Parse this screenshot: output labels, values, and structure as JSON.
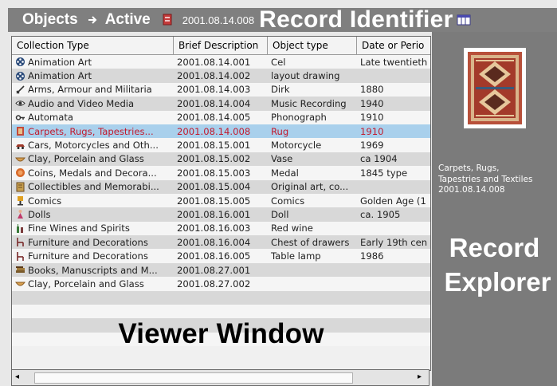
{
  "header": {
    "objects_label": "Objects",
    "active_label": "Active",
    "record_id": "2001.08.14.008",
    "overlay_title": "Record Identifier"
  },
  "list": {
    "columns": [
      "Collection Type",
      "Brief Description",
      "Object type",
      "Date or Perio"
    ],
    "rows": [
      {
        "icon": "film-reel-icon",
        "collection": "Animation Art",
        "brief": "2001.08.14.001",
        "object": "Cel",
        "date": "Late twentieth"
      },
      {
        "icon": "film-reel-icon",
        "collection": "Animation Art",
        "brief": "2001.08.14.002",
        "object": "layout drawing",
        "date": ""
      },
      {
        "icon": "sword-icon",
        "collection": "Arms, Armour and Militaria",
        "brief": "2001.08.14.003",
        "object": "Dirk",
        "date": "1880"
      },
      {
        "icon": "eye-icon",
        "collection": "Audio and Video Media",
        "brief": "2001.08.14.004",
        "object": "Music Recording",
        "date": "1940"
      },
      {
        "icon": "key-icon",
        "collection": "Automata",
        "brief": "2001.08.14.005",
        "object": "Phonograph",
        "date": "1910"
      },
      {
        "icon": "rug-icon",
        "collection": "Carpets, Rugs, Tapestries...",
        "brief": "2001.08.14.008",
        "object": "Rug",
        "date": "1910",
        "selected": true
      },
      {
        "icon": "car-icon",
        "collection": "Cars, Motorcycles and Oth...",
        "brief": "2001.08.15.001",
        "object": "Motorcycle",
        "date": "1969"
      },
      {
        "icon": "bowl-icon",
        "collection": "Clay, Porcelain and Glass",
        "brief": "2001.08.15.002",
        "object": "Vase",
        "date": "ca 1904"
      },
      {
        "icon": "coin-icon",
        "collection": "Coins, Medals and Decora...",
        "brief": "2001.08.15.003",
        "object": "Medal",
        "date": "1845 type"
      },
      {
        "icon": "book-icon",
        "collection": "Collectibles and Memorabi...",
        "brief": "2001.08.15.004",
        "object": "Original art, co...",
        "date": ""
      },
      {
        "icon": "lamp-icon",
        "collection": "Comics",
        "brief": "2001.08.15.005",
        "object": "Comics",
        "date": "Golden Age (1"
      },
      {
        "icon": "doll-icon",
        "collection": "Dolls",
        "brief": "2001.08.16.001",
        "object": "Doll",
        "date": "ca. 1905"
      },
      {
        "icon": "bottle-icon",
        "collection": "Fine Wines and Spirits",
        "brief": "2001.08.16.003",
        "object": "Red wine",
        "date": ""
      },
      {
        "icon": "chair-icon",
        "collection": "Furniture and Decorations",
        "brief": "2001.08.16.004",
        "object": "Chest of drawers",
        "date": "Early 19th cen"
      },
      {
        "icon": "chair-icon",
        "collection": "Furniture and Decorations",
        "brief": "2001.08.16.005",
        "object": "Table lamp",
        "date": "1986"
      },
      {
        "icon": "book-stack-icon",
        "collection": "Books, Manuscripts and M...",
        "brief": "2001.08.27.001",
        "object": "",
        "date": ""
      },
      {
        "icon": "bowl-icon",
        "collection": "Clay, Porcelain and Glass",
        "brief": "2001.08.27.002",
        "object": "",
        "date": ""
      }
    ],
    "overlay_label": "Viewer Window"
  },
  "explorer": {
    "caption_lines": [
      "Carpets, Rugs,",
      "Tapestries and Textiles",
      "2001.08.14.008"
    ],
    "overlay_line1": "Record",
    "overlay_line2": "Explorer"
  },
  "colors": {
    "header_bg": "#7f7f7f",
    "selected_row_bg": "#a9d0ec",
    "selected_row_text": "#c21b2e",
    "explorer_bg": "#7b7b7b"
  }
}
